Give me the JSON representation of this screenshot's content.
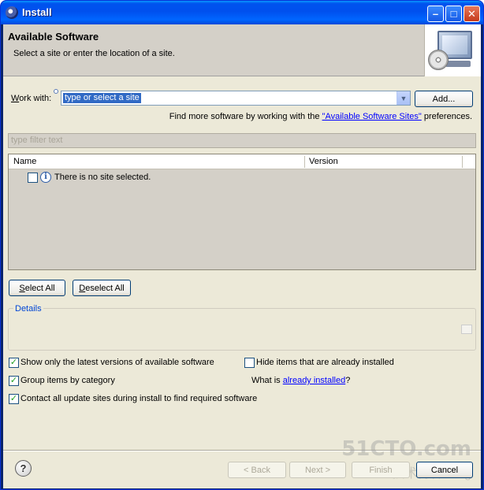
{
  "window": {
    "title": "Install",
    "minimize": "–",
    "maximize": "□",
    "close": "✕"
  },
  "header": {
    "title": "Available Software",
    "subtitle": "Select a site or enter the location of a site.",
    "image_icon": "monitor-with-cd-icon"
  },
  "work_with": {
    "label_prefix": "W",
    "label_rest": "ork with:",
    "value": "type or select a site",
    "add_button": "Add...",
    "find_more_prefix": "Find more software by working with the ",
    "find_more_link": "\"Available Software Sites\"",
    "find_more_suffix": " preferences."
  },
  "filter": {
    "placeholder": "type filter text"
  },
  "table": {
    "columns": [
      "Name",
      "Version"
    ],
    "rows": [
      {
        "checked": false,
        "icon": "info-icon",
        "text": "There is no site selected."
      }
    ]
  },
  "selection_buttons": {
    "select_all": "Select All",
    "deselect_all": "Deselect All"
  },
  "details": {
    "legend": "Details"
  },
  "options": {
    "show_latest": {
      "checked": true,
      "label": "Show only the latest versions of available software"
    },
    "hide_installed": {
      "checked": false,
      "label": "Hide items that are already installed"
    },
    "group_by_category": {
      "checked": true,
      "label": "Group items by category"
    },
    "what_is_prefix": "What is ",
    "what_is_link": "already installed",
    "what_is_suffix": "?",
    "contact_sites": {
      "checked": true,
      "label": "Contact all update sites during install to find required software"
    }
  },
  "footer": {
    "help_icon": "question-mark-icon",
    "back": "< Back",
    "next": "Next >",
    "finish": "Finish",
    "cancel": "Cancel"
  },
  "watermark": {
    "line1": "51CTO.com",
    "line2": "技术博客  Blog"
  }
}
